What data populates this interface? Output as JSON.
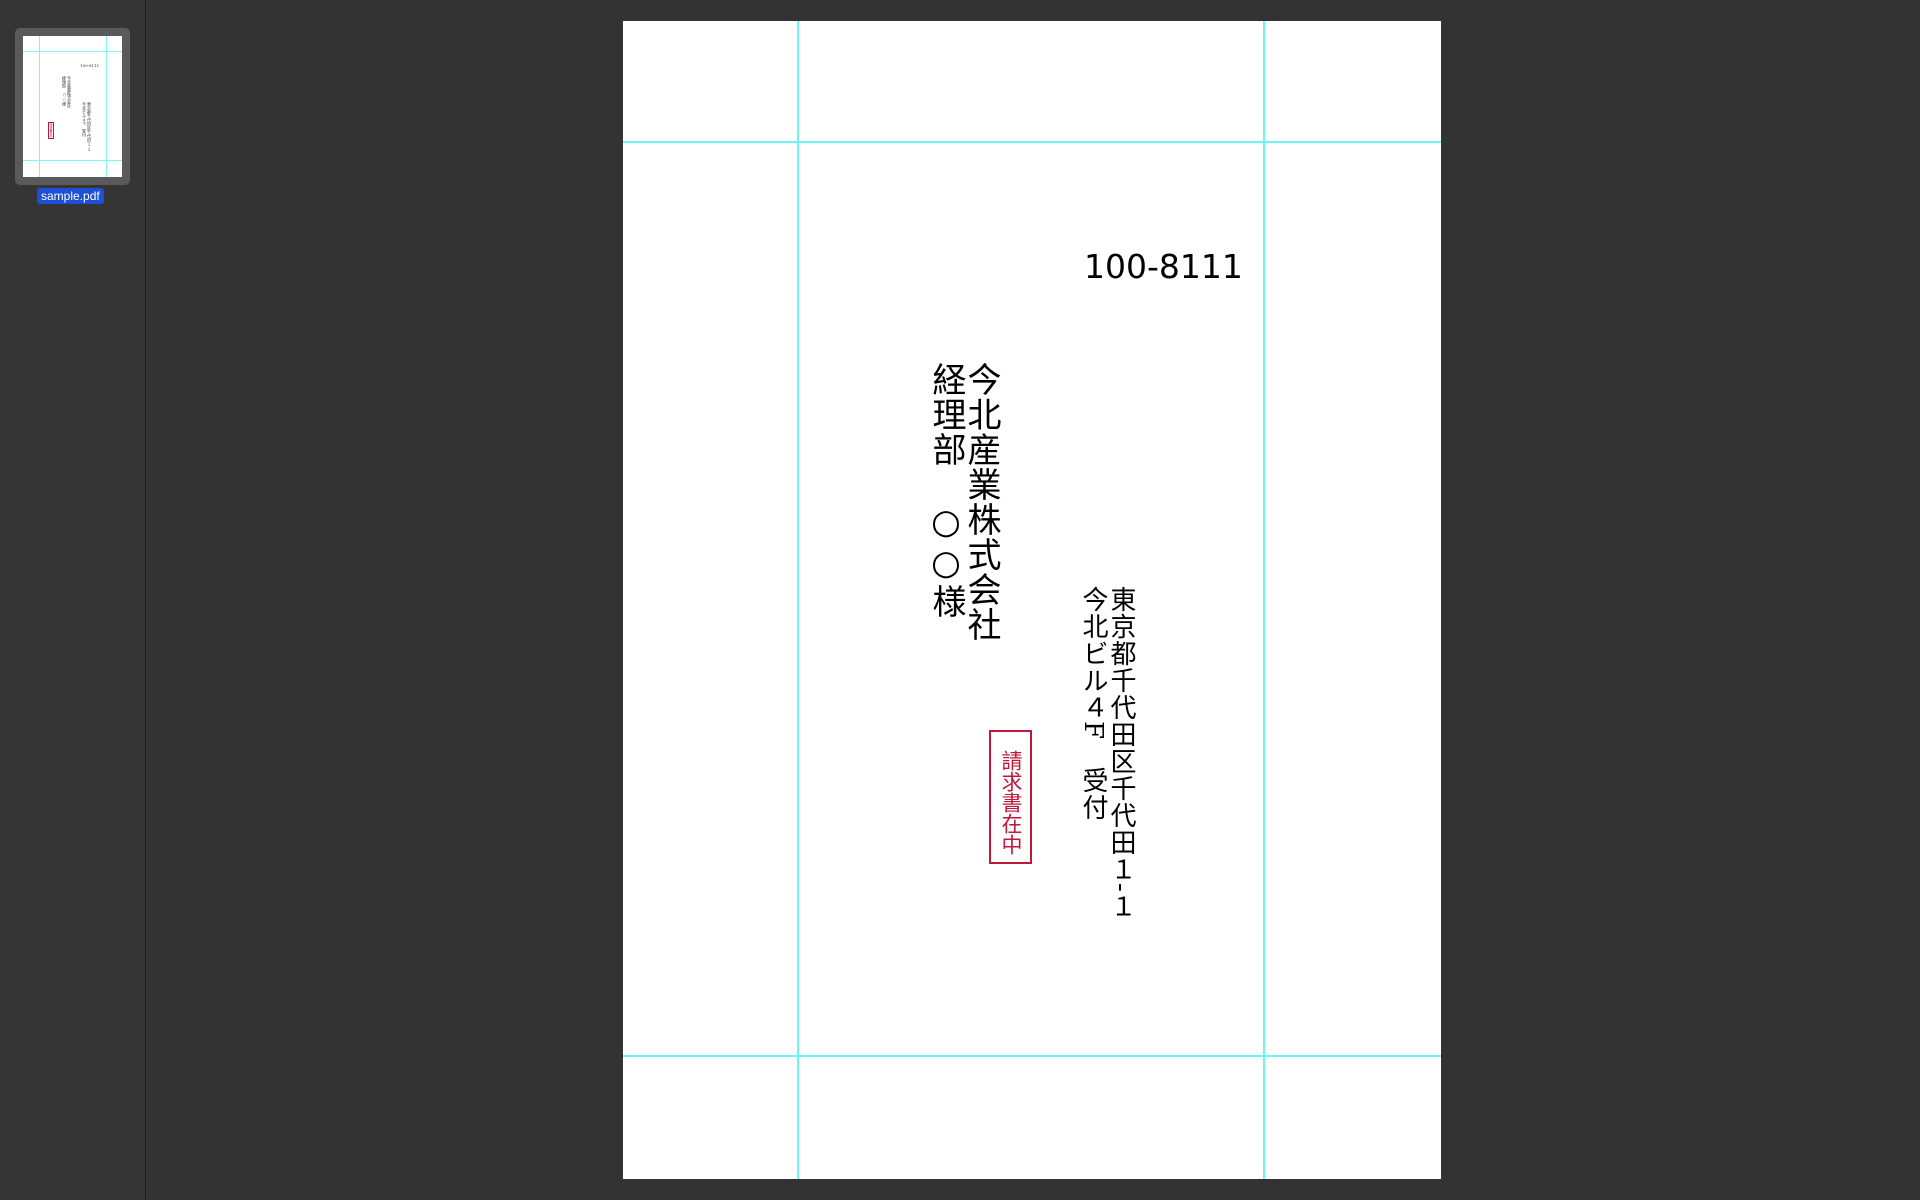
{
  "sidebar": {
    "thumbnail_label": "sample.pdf"
  },
  "document": {
    "postal_code": "100-8111",
    "recipient_lines": [
      "今北産業株式会社",
      "経理部　○○様"
    ],
    "address_lines": [
      "東京都千代田区千代田１-１",
      "今北ビル４F　受付"
    ],
    "stamp_text": "請求書在中",
    "stamp_color": "#c0173a",
    "guide_color": "#6ff4f4"
  }
}
